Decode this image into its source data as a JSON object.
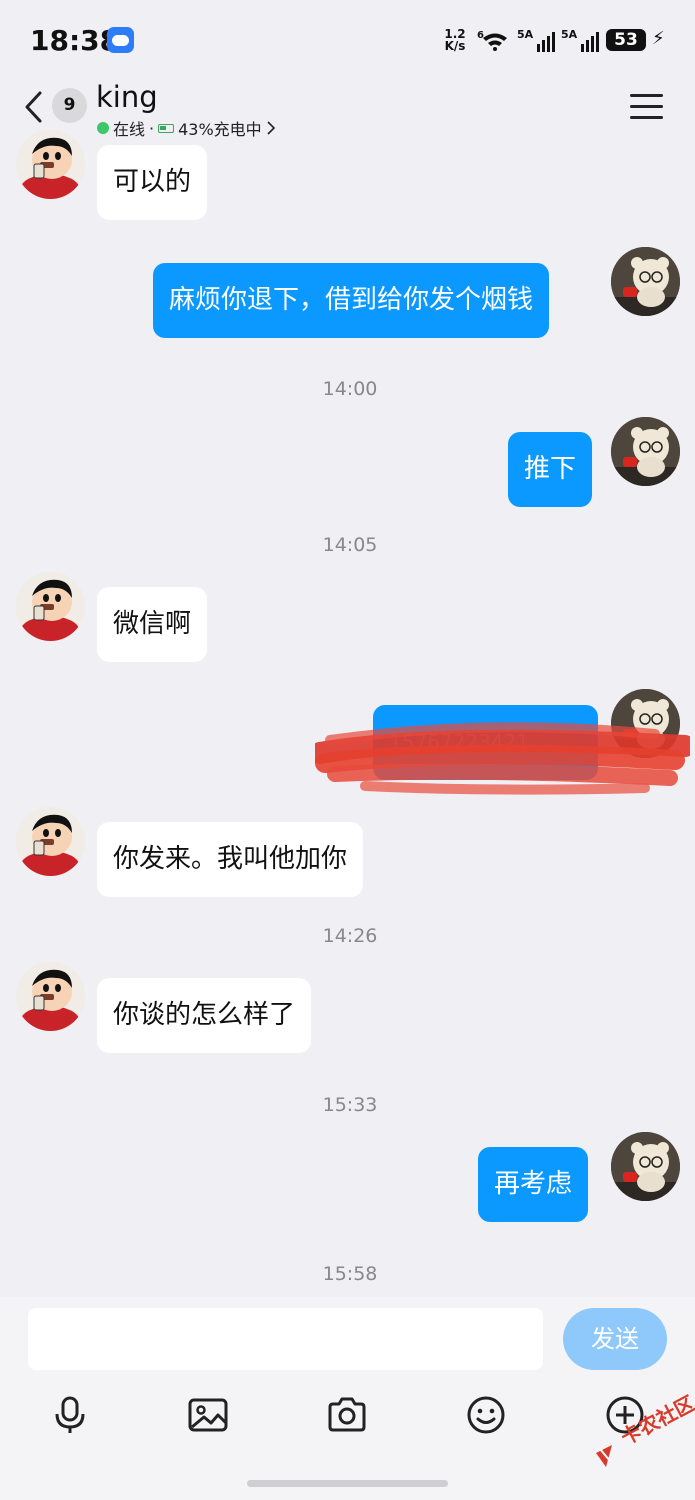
{
  "status_bar": {
    "time": "18:38",
    "net_speed_top": "1.2",
    "net_speed_bottom": "K/s",
    "wifi_label": "6",
    "sim1_label": "5A",
    "sim2_label": "5A",
    "battery": "53",
    "icons": [
      "weather-icon",
      "wifi-icon",
      "signal-icon",
      "signal-icon",
      "battery-icon",
      "charging-bolt-icon"
    ]
  },
  "header": {
    "unread_count": "9",
    "contact_name": "king",
    "online_status": "在线",
    "separator": "·",
    "battery_status": "43%充电中",
    "icons": [
      "back-icon",
      "menu-icon",
      "chevron-right-icon"
    ]
  },
  "messages": [
    {
      "from": "friend",
      "text": "可以的"
    },
    {
      "from": "me",
      "text": "麻烦你退下，借到给你发个烟钱"
    },
    {
      "type": "time",
      "text": "14:00"
    },
    {
      "from": "me",
      "text": "推下"
    },
    {
      "type": "time",
      "text": "14:05"
    },
    {
      "from": "friend",
      "text": "微信啊"
    },
    {
      "from": "me",
      "text": "15767223421",
      "redacted": true
    },
    {
      "from": "friend",
      "text": "你发来。我叫他加你"
    },
    {
      "type": "time",
      "text": "14:26"
    },
    {
      "from": "friend",
      "text": "你谈的怎么样了"
    },
    {
      "type": "time",
      "text": "15:33"
    },
    {
      "from": "me",
      "text": "再考虑"
    },
    {
      "type": "time",
      "text": "15:58"
    }
  ],
  "input": {
    "value": "",
    "send_label": "发送"
  },
  "toolbar": {
    "icons": [
      "microphone-icon",
      "image-icon",
      "camera-icon",
      "emoji-icon",
      "plus-icon"
    ]
  },
  "watermark": {
    "text": "卡农社区"
  },
  "colors": {
    "background": "#efeff4",
    "my_bubble": "#0b99ff",
    "friend_bubble": "#ffffff",
    "send_button": "#8fc9fb",
    "online": "#3cc76a"
  }
}
